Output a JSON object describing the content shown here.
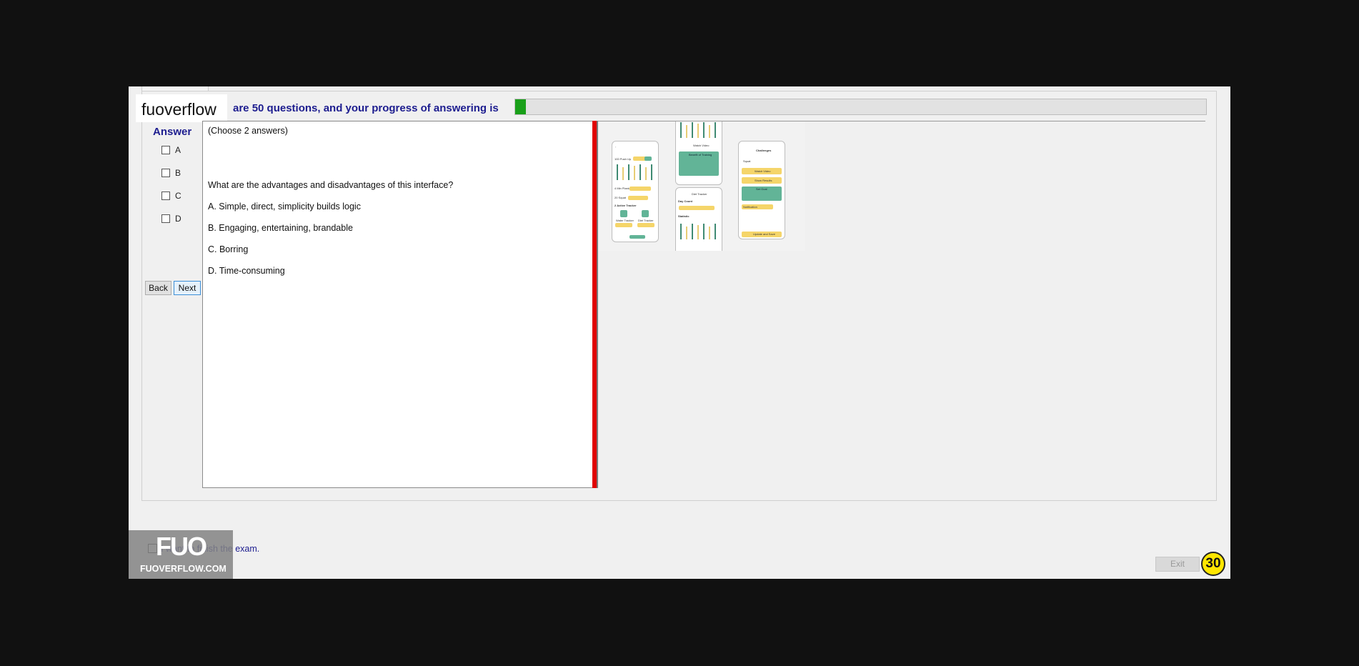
{
  "brand": {
    "watermark": "fuoverflow",
    "logo_mark": "FUO",
    "logo_site": "FUOVERFLOW.COM"
  },
  "header": {
    "progress_text": "are 50 questions, and your progress of answering is",
    "progress_fraction": 0.016
  },
  "answer": {
    "label": "Answer",
    "options": [
      {
        "label": "A"
      },
      {
        "label": "B"
      },
      {
        "label": "C"
      },
      {
        "label": "D"
      }
    ]
  },
  "nav": {
    "back_label": "Back",
    "next_label": "Next"
  },
  "question": {
    "instruction": "(Choose 2 answers)",
    "prompt": "What are the advantages and disadvantages of this interface?",
    "choices": [
      "A.  Simple, direct, simplicity builds logic",
      "B.   Engaging, entertaining, brandable",
      "C.  Borring",
      "D.  Time-consuming"
    ]
  },
  "wireframe": {
    "left_phone": {
      "title": "100 Push Up",
      "row2": "4 Min Plank",
      "row3": "20 Squat",
      "section": "2 Active Tracker",
      "tile1": "Water Tracker",
      "tile2": "Diet Tracker"
    },
    "middle_phone": {
      "watch_label": "Watch Video",
      "benefits_title": "Benefit of Training",
      "lower_header": "Diet Tracker",
      "day_count": "Day Count",
      "statistic": "Statistic"
    },
    "right_phone": {
      "title": "Challenges",
      "dropdown": "Squat",
      "btn1": "Watch Video",
      "btn2": "Show Results",
      "set_goal": "Set Goal",
      "notification": "Notification",
      "update": "Update and Save"
    }
  },
  "footer": {
    "finish_text": "I want to finish the exam.",
    "exit_label": "Exit",
    "timer": "30"
  },
  "colors": {
    "accent_text": "#1d1d8f",
    "divider": "#e00000",
    "progress": "#19a019",
    "timer_bg": "#ffe600"
  }
}
